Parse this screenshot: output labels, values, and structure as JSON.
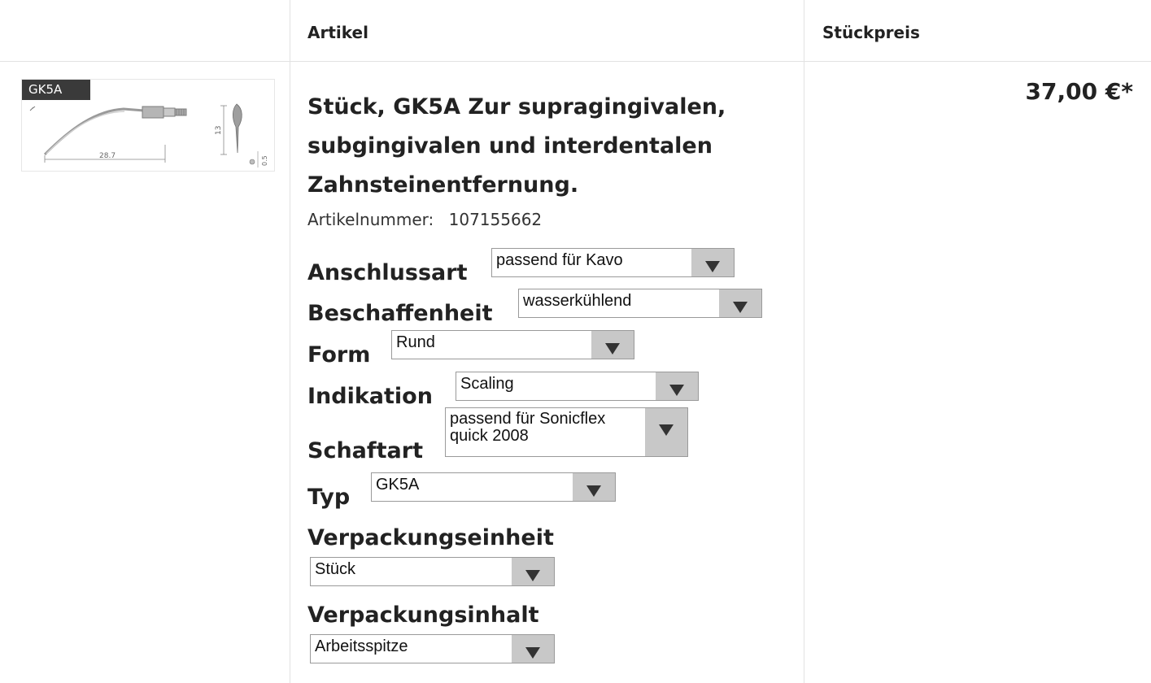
{
  "table": {
    "col_artikel": "Artikel",
    "col_stueckpreis": "Stückpreis"
  },
  "product": {
    "image_badge": "GK5A",
    "image_dims": [
      "28.7",
      "13",
      "0.5"
    ],
    "title": "Stück, GK5A Zur supragingivalen, subgingivalen und interdentalen Zahnsteinentfernung.",
    "article_number_label": "Artikelnummer:",
    "article_number": "107155662",
    "price": "37,00 €*"
  },
  "options": {
    "anschlussart": {
      "label": "Anschlussart",
      "value": "passend für Kavo"
    },
    "beschaffenheit": {
      "label": "Beschaffenheit",
      "value": "wasserkühlend"
    },
    "form": {
      "label": "Form",
      "value": "Rund"
    },
    "indikation": {
      "label": "Indikation",
      "value": "Scaling"
    },
    "schaftart": {
      "label": "Schaftart",
      "value": "passend für Sonicflex quick 2008"
    },
    "typ": {
      "label": "Typ",
      "value": "GK5A"
    },
    "verpackungseinheit": {
      "label": "Verpackungseinheit",
      "value": "Stück"
    },
    "verpackungsinhalt": {
      "label": "Verpackungsinhalt",
      "value": "Arbeitsspitze"
    }
  }
}
